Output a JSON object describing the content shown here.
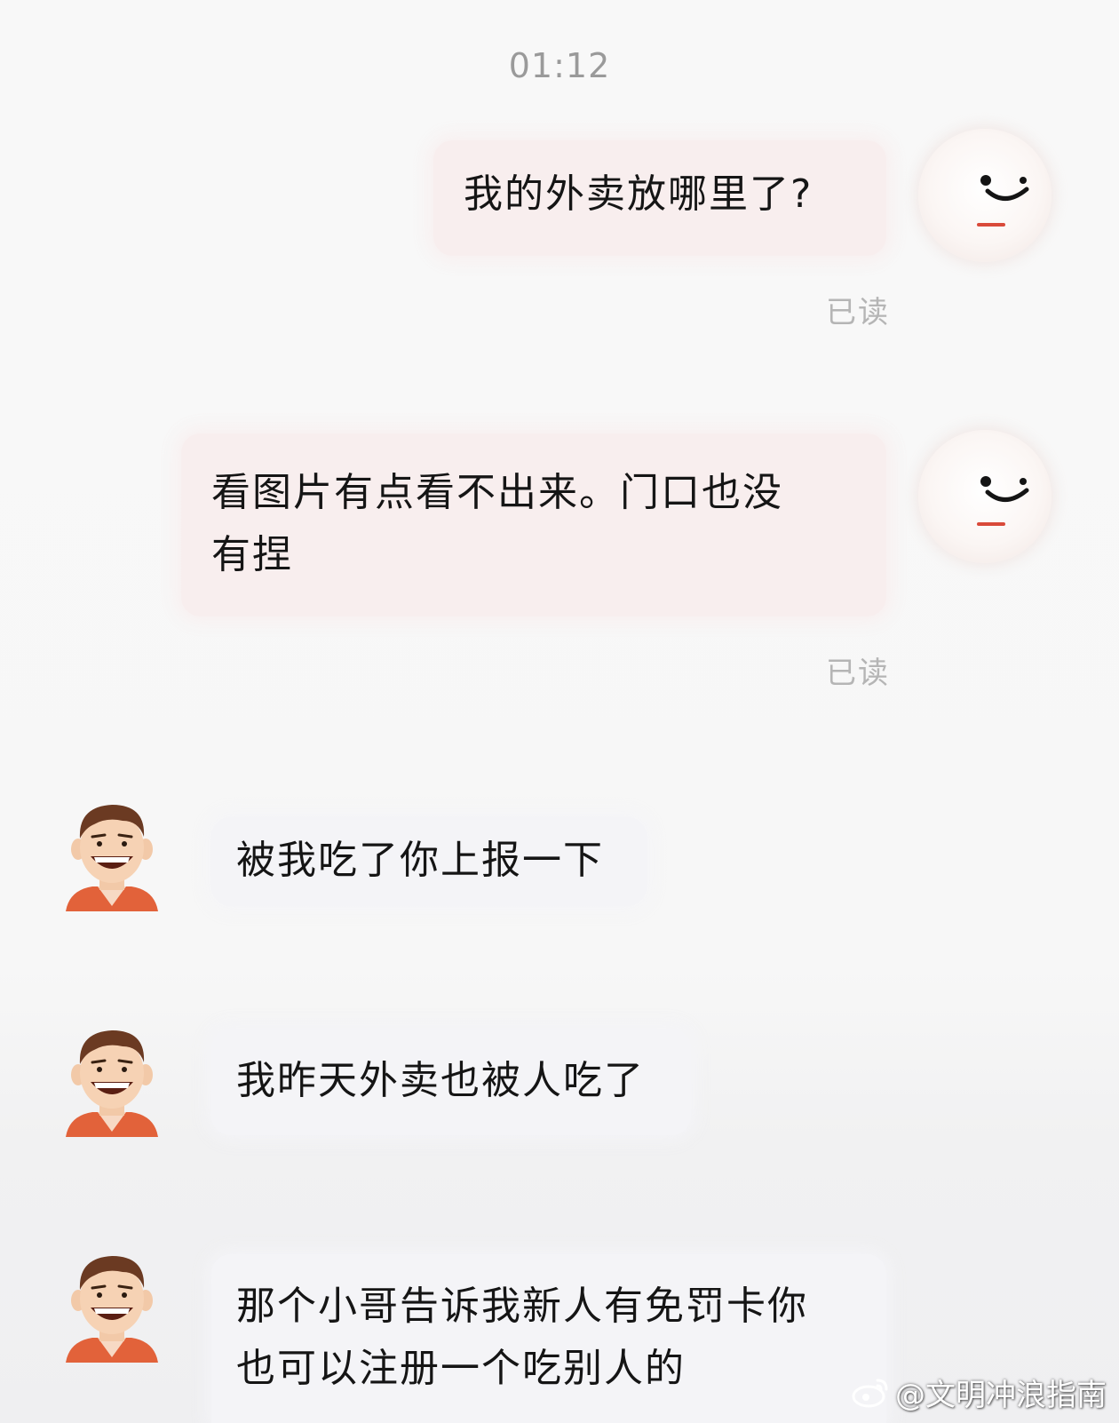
{
  "chat": {
    "timestamp": "01:12",
    "messages": [
      {
        "sender": "self",
        "text": "我的外卖放哪里了?",
        "status": "已读"
      },
      {
        "sender": "self",
        "lines": [
          "看图片有点看不出来。门口也没",
          "有捏"
        ],
        "status": "已读"
      },
      {
        "sender": "other",
        "text": "被我吃了你上报一下"
      },
      {
        "sender": "other",
        "text": "我昨天外卖也被人吃了"
      },
      {
        "sender": "other",
        "lines": [
          "那个小哥告诉我新人有免罚卡你",
          "也可以注册一个吃别人的"
        ]
      }
    ]
  },
  "watermark": {
    "text": "@文明冲浪指南",
    "icon": "weibo-icon"
  },
  "colors": {
    "self_bubble": "#f8eeee",
    "other_bubble": "#f4f4f7",
    "avatar_shirt": "#e2623a",
    "avatar_hair": "#6b3a22"
  }
}
